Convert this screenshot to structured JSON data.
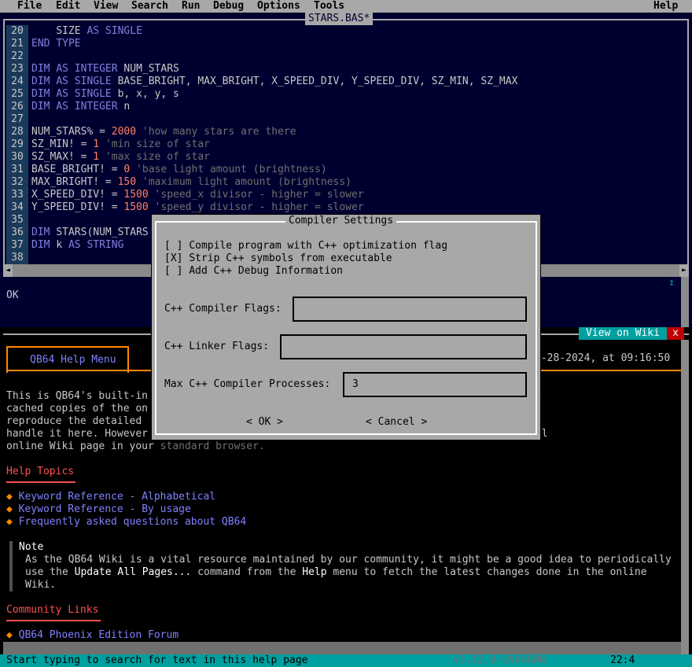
{
  "menubar": {
    "items": [
      "File",
      "Edit",
      "View",
      "Search",
      "Run",
      "Debug",
      "Options",
      "Tools"
    ],
    "help": "Help"
  },
  "editor": {
    "title": "STARS.BAS*",
    "lines": [
      {
        "n": "20",
        "text": "    SIZE AS SINGLE"
      },
      {
        "n": "21",
        "text": "END TYPE"
      },
      {
        "n": "22",
        "text": ""
      },
      {
        "n": "23",
        "text": "DIM AS INTEGER NUM_STARS"
      },
      {
        "n": "24",
        "text": "DIM AS SINGLE BASE_BRIGHT, MAX_BRIGHT, X_SPEED_DIV, Y_SPEED_DIV, SZ_MIN, SZ_MAX"
      },
      {
        "n": "25",
        "text": "DIM AS SINGLE b, x, y, s"
      },
      {
        "n": "26",
        "text": "DIM AS INTEGER n"
      },
      {
        "n": "27",
        "text": ""
      },
      {
        "n": "28",
        "text": "NUM_STARS% = 2000 'how many stars are there"
      },
      {
        "n": "29",
        "text": "SZ_MIN! = 1 'min size of star"
      },
      {
        "n": "30",
        "text": "SZ_MAX! = 1 'max size of star"
      },
      {
        "n": "31",
        "text": "BASE_BRIGHT! = 0 'base light amount (brightness)"
      },
      {
        "n": "32",
        "text": "MAX_BRIGHT! = 150 'maximum light amount (brightness)"
      },
      {
        "n": "33",
        "text": "X_SPEED_DIV! = 1500 'speed_x divisor - higher = slower"
      },
      {
        "n": "34",
        "text": "Y_SPEED_DIV! = 1500 'speed_y divisor - higher = slower"
      },
      {
        "n": "35",
        "text": ""
      },
      {
        "n": "36",
        "text": "DIM STARS(NUM_STARS"
      },
      {
        "n": "37",
        "text": "DIM k AS STRING"
      },
      {
        "n": "38",
        "text": ""
      }
    ]
  },
  "status_pane": {
    "text": "OK"
  },
  "help": {
    "view_on_wiki": "View on Wiki",
    "close": "x",
    "menu_tab": "QB64 Help Menu",
    "date_text": "3-28-2024, at 09:16:50",
    "intro_lines": [
      "This is QB64's built-in                                          e pages shown here are",
      "cached copies of the on                                          bviously we can't",
      "reproduce the detailed                                           re too complex to",
      "handle it here. However                                          me to open the original",
      "online Wiki page in your "
    ],
    "standard_browser": "standard browser.",
    "help_topics": "Help Topics",
    "topics": [
      "Keyword Reference - Alphabetical",
      "Keyword Reference - By usage",
      "Frequently asked questions about QB64"
    ],
    "note_title": "Note",
    "note_line1": "As the QB64 Wiki is a vital resource maintained by our community, it might be a good idea to periodically",
    "note_line2_a": "use the ",
    "note_line2_b": "Update All Pages...",
    "note_line2_c": " command from the ",
    "note_line2_d": "Help",
    "note_line2_e": " menu to fetch the latest changes done in the online",
    "note_line3": "Wiki.",
    "community_links": "Community Links",
    "forum": "QB64 Phoenix Edition Forum"
  },
  "statusbar": {
    "text": "Start typing to search for text in this help page",
    "version": "v3.12.0-UNKNOWN",
    "position": "22:4"
  },
  "dialog": {
    "title": "Compiler Settings",
    "options": [
      {
        "check": "[ ]",
        "label": "Compile program with C++ optimization flag"
      },
      {
        "check": "[X]",
        "label": "Strip C++ symbols from executable"
      },
      {
        "check": "[ ]",
        "label": "Add C++ Debug Information"
      }
    ],
    "compiler_flags_label": "C++ Compiler Flags:",
    "compiler_flags_value": "",
    "linker_flags_label": "C++ Linker Flags:",
    "linker_flags_value": "",
    "max_processes_label": "Max C++ Compiler Processes:",
    "max_processes_value": "3",
    "ok": "< OK >",
    "cancel": "< Cancel >"
  },
  "colors": {
    "editor_bg": "#000030",
    "gutter_bg": "#1a3a5a",
    "keyword": "#8080e0",
    "number": "#ff8060",
    "comment": "#707070",
    "link": "#8080ff",
    "accent": "#ff8800",
    "heading": "#ff5050",
    "statusbar_bg": "#00a0a0",
    "dialog_bg": "#a8a8a8"
  }
}
